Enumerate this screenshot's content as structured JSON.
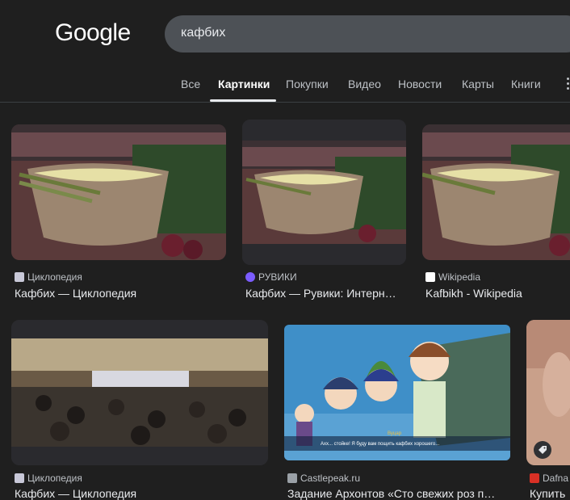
{
  "header": {
    "logo": "Google",
    "search_query": "кафбих"
  },
  "tabs": [
    {
      "label": "Все",
      "active": false
    },
    {
      "label": "Картинки",
      "active": true
    },
    {
      "label": "Покупки",
      "active": false
    },
    {
      "label": "Видео",
      "active": false
    },
    {
      "label": "Новости",
      "active": false
    },
    {
      "label": "Карты",
      "active": false
    },
    {
      "label": "Книги",
      "active": false
    }
  ],
  "results": [
    {
      "source": "Циклопедия",
      "title": "Кафбих — Циклопедия",
      "favicon_color": "#c8c8d8"
    },
    {
      "source": "РУВИКИ",
      "title": "Кафбих — Рувики: Интерн…",
      "favicon_color": "#7b5cff"
    },
    {
      "source": "Wikipedia",
      "title": "Kafbikh - Wikipedia",
      "favicon_color": "#ffffff"
    },
    {
      "source": "Циклопедия",
      "title": "Кафбих — Циклопедия",
      "favicon_color": "#c8c8d8"
    },
    {
      "source": "Castlepeak.ru",
      "title": "Задание Архонтов «Сто свежих роз п…",
      "favicon_color": "#9aa0a6"
    },
    {
      "source": "Dafna",
      "title": "Купить",
      "favicon_color": "#d93025"
    }
  ],
  "image_text": {
    "game_speaker": "Вуцар",
    "game_dialogue": "Ахх... стойке! Я буду вам пощить кафбих хорошего..."
  },
  "colors": {
    "background": "#1f1f1f",
    "search_bg": "#4d5156",
    "accent_text": "#e8eaed"
  }
}
